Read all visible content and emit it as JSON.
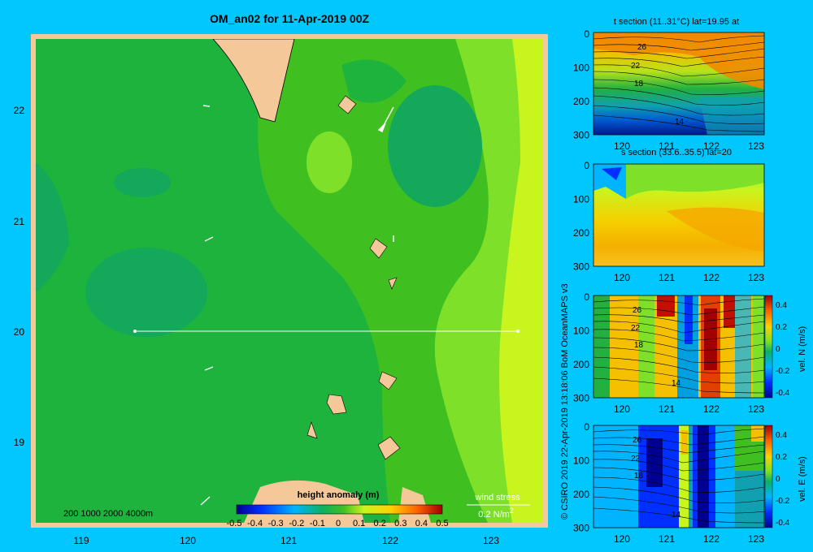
{
  "colors": {
    "background": "#00c8ff",
    "land": "#f5c89a",
    "map_border": "#f5c89a",
    "ocean_low": "#13a85a",
    "ocean_mid": "#1db33c",
    "ocean_high": "#7fe02a",
    "ocean_top": "#c8f51e"
  },
  "map": {
    "title": "OM_an02 for 11-Apr-2019 00Z",
    "x_ticks": [
      "119",
      "120",
      "121",
      "122",
      "123"
    ],
    "y_ticks": [
      "22",
      "21",
      "20",
      "19"
    ],
    "depth_legend": "200  1000  2000  4000m",
    "wind_stress_label": "wind stress",
    "wind_stress_units": "0.2 N/m",
    "wind_stress_units_exp": "2"
  },
  "colorbar": {
    "title": "height anomaly (m)",
    "ticks": [
      "-0.5",
      "-0.4",
      "-0.3",
      "-0.2",
      "-0.1",
      "0",
      "0.1",
      "0.2",
      "0.3",
      "0.4",
      "0.5"
    ]
  },
  "side_label": "© CSIRO 2019   22-Apr-2019 13:18:06 BoM OceanMAPS v3",
  "panels": [
    {
      "title": "t section (11..31°C) lat=19.95 at",
      "y_ticks": [
        "0",
        "100",
        "200",
        "300"
      ],
      "x_ticks": [
        "120",
        "121",
        "122",
        "123"
      ],
      "contour_labels": [
        "26",
        "22",
        "18",
        "14"
      ]
    },
    {
      "title": "s section (33.6..35.5) lat=20",
      "y_ticks": [
        "0",
        "100",
        "200",
        "300"
      ],
      "x_ticks": [
        "120",
        "121",
        "122",
        "123"
      ],
      "contour_labels": []
    },
    {
      "title": "",
      "y_ticks": [
        "0",
        "100",
        "200",
        "300"
      ],
      "x_ticks": [
        "120",
        "121",
        "122",
        "123"
      ],
      "contour_labels": [
        "26",
        "22",
        "18",
        "14"
      ],
      "cbar_ticks": [
        "0.4",
        "0.2",
        "0",
        "-0.2",
        "-0.4"
      ],
      "cbar_label": "vel. N  (m/s)"
    },
    {
      "title": "",
      "y_ticks": [
        "0",
        "100",
        "200",
        "300"
      ],
      "x_ticks": [
        "120",
        "121",
        "122",
        "123"
      ],
      "contour_labels": [
        "26",
        "22",
        "18",
        "14"
      ],
      "cbar_ticks": [
        "0.4",
        "0.2",
        "0",
        "-0.2",
        "-0.4"
      ],
      "cbar_label": "vel. E  (m/s)"
    }
  ],
  "chart_data": [
    {
      "type": "heatmap",
      "title": "OM_an02 for 11-Apr-2019 00Z",
      "xlabel": "",
      "ylabel": "",
      "xlim": [
        118.5,
        123.5
      ],
      "ylim": [
        18.3,
        22.7
      ],
      "colorbar_title": "height anomaly (m)",
      "colorbar_range": [
        -0.5,
        0.5
      ],
      "section_line": {
        "lat": 20,
        "lon_from": 119.5,
        "lon_to": 123.2
      },
      "wind_stress_reference": "0.2 N/m2"
    },
    {
      "type": "heatmap",
      "title": "t section (11..31°C) lat=19.95 at",
      "xlim": [
        119.5,
        123.2
      ],
      "ylim": [
        300,
        0
      ],
      "value_range": [
        11,
        31
      ],
      "contours": [
        26,
        22,
        18,
        14
      ]
    },
    {
      "type": "heatmap",
      "title": "s section (33.6..35.5) lat=20",
      "xlim": [
        119.5,
        123.2
      ],
      "ylim": [
        300,
        0
      ],
      "value_range": [
        33.6,
        35.5
      ]
    },
    {
      "type": "heatmap",
      "title": "",
      "colorbar_label": "vel. N  (m/s)",
      "xlim": [
        119.5,
        123.2
      ],
      "ylim": [
        300,
        0
      ],
      "colorbar_range": [
        -0.4,
        0.4
      ],
      "contours": [
        26,
        22,
        18,
        14
      ]
    },
    {
      "type": "heatmap",
      "title": "",
      "colorbar_label": "vel. E  (m/s)",
      "xlim": [
        119.5,
        123.2
      ],
      "ylim": [
        300,
        0
      ],
      "colorbar_range": [
        -0.4,
        0.4
      ],
      "contours": [
        26,
        22,
        18,
        14
      ]
    }
  ]
}
